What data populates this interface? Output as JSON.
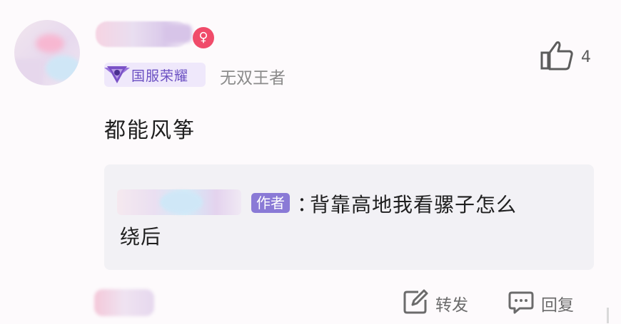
{
  "comment": {
    "badge": {
      "label": "国服荣耀",
      "icon": "rank-emblem-icon"
    },
    "rank_title": "无双王者",
    "text": "都能风筝",
    "likes": "4",
    "gender_icon": "♀",
    "quote": {
      "author_tag": "作者",
      "colon": "：",
      "text_line1": "背靠高地我看骡子怎么",
      "text_line2": "绕后"
    },
    "actions": {
      "forward_label": "转发",
      "reply_label": "回复"
    }
  },
  "colors": {
    "badge_text": "#6a4fc2",
    "author_tag_bg": "#8a7ad6",
    "gender": "#f04b6a"
  }
}
